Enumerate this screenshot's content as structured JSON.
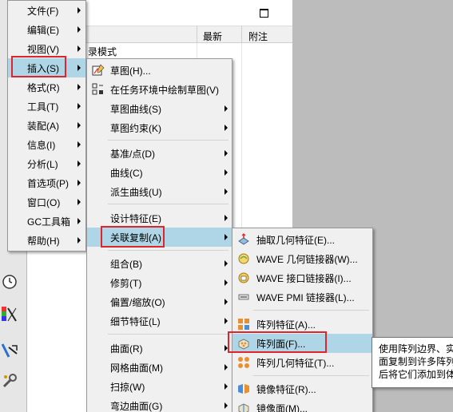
{
  "panel": {
    "col_latest": "最新",
    "col_note": "附注",
    "tree_text": "录模式"
  },
  "main_menu": [
    {
      "label": "文件(F)",
      "arrow": true
    },
    {
      "label": "编辑(E)",
      "arrow": true
    },
    {
      "label": "视图(V)",
      "arrow": true
    },
    {
      "label": "插入(S)",
      "arrow": true,
      "highlighted": true
    },
    {
      "label": "格式(R)",
      "arrow": true
    },
    {
      "label": "工具(T)",
      "arrow": true
    },
    {
      "label": "装配(A)",
      "arrow": true
    },
    {
      "label": "信息(I)",
      "arrow": true
    },
    {
      "label": "分析(L)",
      "arrow": true
    },
    {
      "label": "首选项(P)",
      "arrow": true
    },
    {
      "label": "窗口(O)",
      "arrow": true
    },
    {
      "label": "GC工具箱",
      "arrow": true
    },
    {
      "label": "帮助(H)",
      "arrow": true
    }
  ],
  "insert_menu": [
    {
      "label": "草图(H)...",
      "icon": "sketch-icon"
    },
    {
      "label": "在任务环境中绘制草图(V)",
      "icon": "sketch-task-icon"
    },
    {
      "label": "草图曲线(S)",
      "arrow": true
    },
    {
      "label": "草图约束(K)",
      "arrow": true
    },
    {
      "label": "基准/点(D)",
      "arrow": true
    },
    {
      "label": "曲线(C)",
      "arrow": true
    },
    {
      "label": "派生曲线(U)",
      "arrow": true
    },
    {
      "label": "设计特征(E)",
      "arrow": true
    },
    {
      "label": "关联复制(A)",
      "arrow": true,
      "highlighted": true
    },
    {
      "label": "组合(B)",
      "arrow": true
    },
    {
      "label": "修剪(T)",
      "arrow": true
    },
    {
      "label": "偏置/缩放(O)",
      "arrow": true
    },
    {
      "label": "细节特征(L)",
      "arrow": true
    },
    {
      "label": "曲面(R)",
      "arrow": true
    },
    {
      "label": "网格曲面(M)",
      "arrow": true
    },
    {
      "label": "扫掠(W)",
      "arrow": true
    },
    {
      "label": "弯边曲面(G)",
      "arrow": true
    }
  ],
  "copy_menu": [
    {
      "label": "抽取几何特征(E)...",
      "icon": "extract-geometry-icon"
    },
    {
      "label": "WAVE 几何链接器(W)...",
      "icon": "wave-geometry-linker-icon"
    },
    {
      "label": "WAVE 接口链接器(I)...",
      "icon": "wave-interface-linker-icon"
    },
    {
      "label": "WAVE PMI 链接器(L)...",
      "icon": "wave-pmi-linker-icon"
    },
    {
      "label": "阵列特征(A)...",
      "icon": "pattern-feature-icon"
    },
    {
      "label": "阵列面(F)...",
      "icon": "pattern-face-icon",
      "highlighted": true
    },
    {
      "label": "阵列几何特征(T)...",
      "icon": "pattern-geometry-icon"
    },
    {
      "label": "镜像特征(R)...",
      "icon": "mirror-feature-icon"
    },
    {
      "label": "镜像面(M)...",
      "icon": "mirror-face-icon"
    }
  ],
  "tooltip": {
    "line1": "使用阵列边界、实",
    "line2": "面复制到许多阵列",
    "line3": "后将它们添加到体"
  },
  "colors": {
    "highlight": "#aed6e6",
    "red_box": "#e0242b",
    "menu_bg": "#f0f0f0"
  }
}
